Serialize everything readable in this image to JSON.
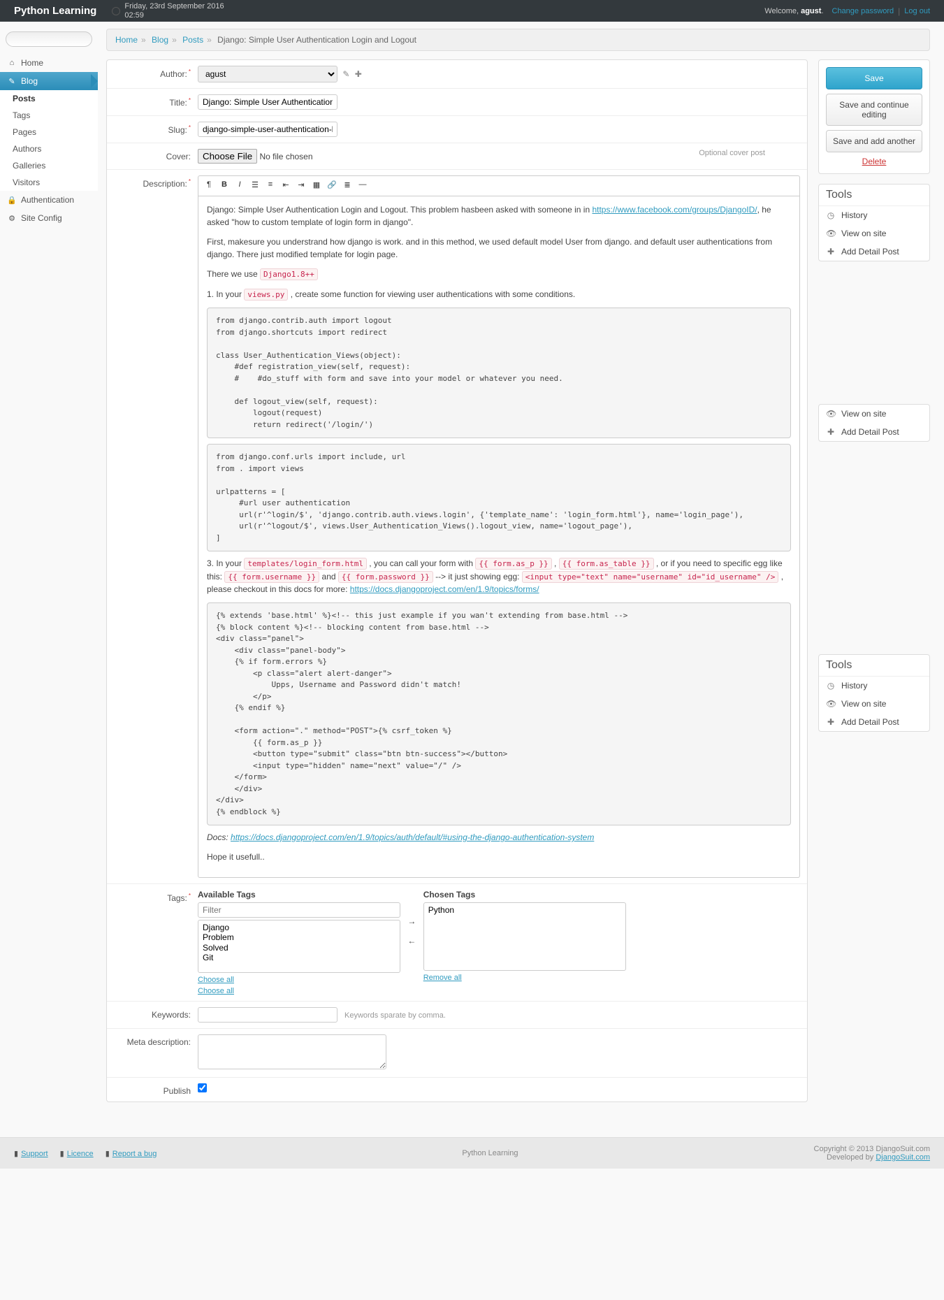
{
  "header": {
    "brand": "Python Learning",
    "date": "Friday, 23rd September 2016",
    "time": "02:59",
    "welcome_prefix": "Welcome, ",
    "username": "agust",
    "welcome_suffix": ".",
    "change_password": "Change password",
    "logout": "Log out"
  },
  "sidebar": {
    "home": "Home",
    "blog": "Blog",
    "sub": {
      "posts": "Posts",
      "tags": "Tags",
      "pages": "Pages",
      "authors": "Authors",
      "galleries": "Galleries",
      "visitors": "Visitors"
    },
    "auth": "Authentication",
    "siteconfig": "Site Config"
  },
  "breadcrumbs": {
    "home": "Home",
    "blog": "Blog",
    "posts": "Posts",
    "current": "Django: Simple User Authentication Login and Logout"
  },
  "labels": {
    "author": "Author:",
    "title": "Title:",
    "slug": "Slug:",
    "cover": "Cover:",
    "desc": "Description:",
    "tags": "Tags:",
    "keywords": "Keywords:",
    "metadesc": "Meta description:",
    "publish": "Publish"
  },
  "values": {
    "author": "agust",
    "title": "Django: Simple User Authentication Login and Logout",
    "slug": "django-simple-user-authentication-login-and-logout",
    "cover_btn": "Choose File",
    "cover_nofile": "No file chosen",
    "cover_help": "Optional cover post",
    "keywords_help": "Keywords sparate by comma."
  },
  "desc": {
    "p1a": "Django: Simple User Authentication Login and Logout. This problem hasbeen asked with someone in in ",
    "p1link": "https://www.facebook.com/groups/DjangoID/",
    "p1b": ", he asked \"how to custom template of login form in django\".",
    "p2": "First, makesure you understrand how django is work. and in this method, we used default model User from django. and default user authentications from django. There just modified template for login page.",
    "p3a": "There we use ",
    "p3code": "Django1.8++",
    "s1a": "1. In your ",
    "s1code": "views.py",
    "s1b": " , create some function for viewing user authentications with some conditions.",
    "code1": "from django.contrib.auth import logout\nfrom django.shortcuts import redirect\n\nclass User_Authentication_Views(object):\n    #def registration_view(self, request):\n    #    #do_stuff with form and save into your model or whatever you need.\n\n    def logout_view(self, request):\n        logout(request)\n        return redirect('/login/')",
    "code2": "from django.conf.urls import include, url\nfrom . import views\n\nurlpatterns = [\n     #url user authentication\n     url(r'^login/$', 'django.contrib.auth.views.login', {'template_name': 'login_form.html'}, name='login_page'),\n     url(r'^logout/$', views.User_Authentication_Views().logout_view, name='logout_page'),\n]",
    "s3a": "3. In your ",
    "s3c1": "templates/login_form.html",
    "s3b": " , you can call your form with ",
    "s3c2": "{{ form.as_p }}",
    "s3comma": " , ",
    "s3c3": "{{ form.as_table }}",
    "s3c": " , or if you need to specific egg like this: ",
    "s3c4": "{{ form.username }}",
    "s3and": "  and  ",
    "s3c5": "{{ form.password }}",
    "s3d": "  --> it just showing egg: ",
    "s3c6": "<input type=\"text\" name=\"username\" id=\"id_username\" />",
    "s3e": " , please checkout in this docs for more: ",
    "s3link": "https://docs.djangoproject.com/en/1.9/topics/forms/",
    "code3": "{% extends 'base.html' %}<!-- this just example if you wan't extending from base.html -->\n{% block content %}<!-- blocking content from base.html -->\n<div class=\"panel\">\n    <div class=\"panel-body\">\n    {% if form.errors %}\n        <p class=\"alert alert-danger\">\n            Upps, Username and Password didn't match!\n        </p>\n    {% endif %}\n\n    <form action=\".\" method=\"POST\">{% csrf_token %}\n        {{ form.as_p }}\n        <button type=\"submit\" class=\"btn btn-success\"></button>\n        <input type=\"hidden\" name=\"next\" value=\"/\" />\n    </form>\n    </div>\n</div>\n{% endblock %}",
    "docs_a": "Docs: ",
    "docs_link": "https://docs.djangoproject.com/en/1.9/topics/auth/default/#using-the-django-authentication-system",
    "hope": "Hope it usefull.."
  },
  "tags": {
    "avail_hdr": "Available Tags",
    "chosen_hdr": "Chosen Tags",
    "filter": "Filter",
    "avail": [
      "Django",
      "Problem",
      "Solved",
      "Git"
    ],
    "chosen": [
      "Python"
    ],
    "choose_all": "Choose all",
    "remove_all": "Remove all"
  },
  "buttons": {
    "save": "Save",
    "save_cont": "Save and continue editing",
    "save_add": "Save and add another",
    "delete": "Delete"
  },
  "tools": {
    "hdr": "Tools",
    "history": "History",
    "view": "View on site",
    "add": "Add Detail Post"
  },
  "footer": {
    "support": "Support",
    "licence": "Licence",
    "report": "Report a bug",
    "center": "Python Learning",
    "c1": "Copyright © 2013 DjangoSuit.com",
    "c2a": "Developed by ",
    "c2b": "DjangoSuit.com"
  }
}
